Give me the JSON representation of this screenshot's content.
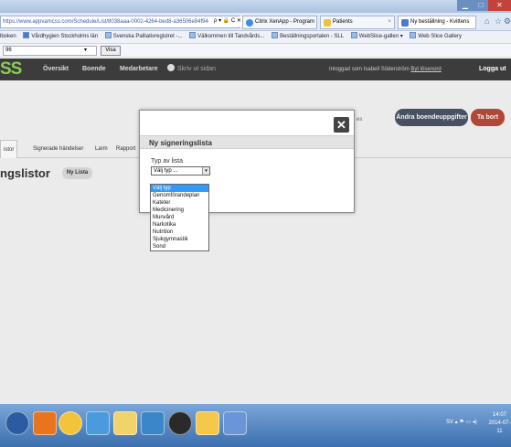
{
  "browser": {
    "url": "https://www.appvamcss.com/Schedule/List/8038aaa-0002-4264-bed8-a36506e84f94",
    "url_controls": "ρ ▾ 🔒 C ✕",
    "tabs": [
      {
        "label": "Citrix XenApp - Program",
        "color": "#3a8ee0"
      },
      {
        "label": "Patients",
        "color": "#f0c040"
      },
      {
        "label": "Ny beställning - Kvittens",
        "color": "#4a7ad0"
      }
    ],
    "favorites": [
      "lboken",
      "Vårdhygien Stockholms län",
      "Svenska Palliativregistret -...",
      "Välkommen till Tandvårds...",
      "Beställningsportalen - SLL",
      "WebSlice-gallen ▾",
      "Web Slice Gallery"
    ],
    "zoom": "96",
    "visa": "Visa"
  },
  "app": {
    "logo": "SS",
    "nav": [
      "Översikt",
      "Boende",
      "Medarbetare"
    ],
    "skriv_ut": "Skriv ut sidan",
    "inloggad": "Inloggad som Isabell Söderström",
    "byt_lösenord": "Byt lösenord",
    "logga_ut": "Logga ut",
    "andra_btn": "Ändra boendeuppgifter",
    "tabort_btn": "Ta bort",
    "tabs": [
      "istor",
      "Signerade händelser",
      "Larm",
      "Rapport"
    ],
    "heading": "ngslistor",
    "ny_lista": "Ny Lista",
    "ghost": "es"
  },
  "modal": {
    "title": "Ny signeringslista",
    "close": "✕",
    "typ_label": "Typ av lista",
    "selected": "Välj typ ...",
    "options": [
      "Välj typ",
      "Genomförandeplan",
      "Kateter",
      "Medicinering",
      "Munvård",
      "Narkotika",
      "Nutrition",
      "Sjukgymnastik",
      "Sond"
    ]
  },
  "taskbar": {
    "lang": "SV",
    "time": "14:07",
    "date": "2014-07-11"
  }
}
